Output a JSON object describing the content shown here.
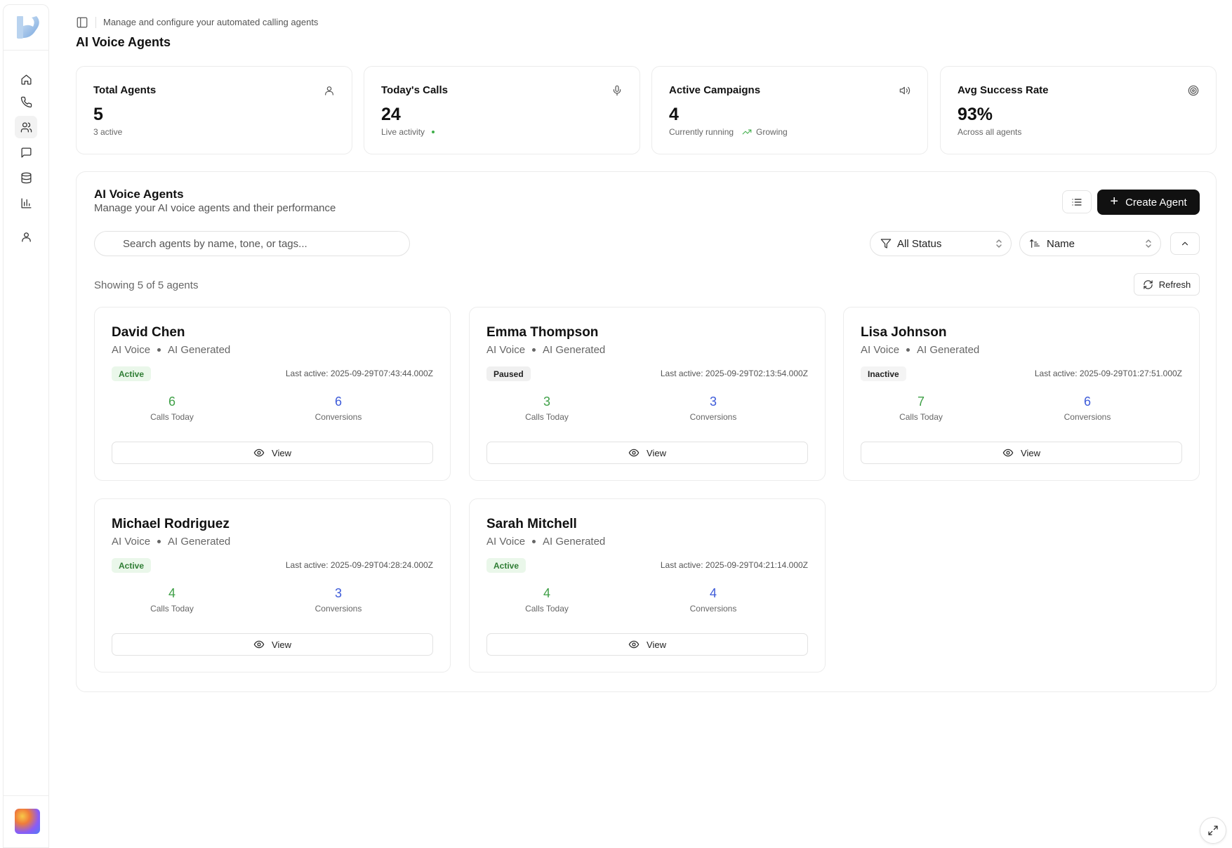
{
  "header": {
    "subtitle": "Manage and configure your automated calling agents",
    "title": "AI Voice Agents"
  },
  "sidebar": {
    "items": [
      {
        "icon": "home-icon"
      },
      {
        "icon": "phone-icon"
      },
      {
        "icon": "users-icon",
        "active": true
      },
      {
        "icon": "message-icon"
      },
      {
        "icon": "database-icon"
      },
      {
        "icon": "bar-chart-icon"
      },
      {
        "icon": "user-icon"
      }
    ]
  },
  "stats": [
    {
      "title": "Total Agents",
      "value": "5",
      "sub": "3 active",
      "icon": "user-icon"
    },
    {
      "title": "Today's Calls",
      "value": "24",
      "sub": "Live activity",
      "icon": "mic-icon"
    },
    {
      "title": "Active Campaigns",
      "value": "4",
      "sub": "Currently running",
      "trend": "Growing",
      "icon": "volume-icon"
    },
    {
      "title": "Avg Success Rate",
      "value": "93%",
      "sub": "Across all agents",
      "icon": "target-icon"
    }
  ],
  "panel": {
    "title": "AI Voice Agents",
    "description": "Manage your AI voice agents and their performance",
    "create_label": "Create Agent",
    "search_placeholder": "Search agents by name, tone, or tags...",
    "status_filter": "All Status",
    "sort_field": "Name",
    "showing": "Showing 5 of 5 agents",
    "refresh_label": "Refresh"
  },
  "agents": [
    {
      "name": "David Chen",
      "voice": "AI Voice",
      "source": "AI Generated",
      "status": "Active",
      "last_active": "Last active: 2025-09-29T07:43:44.000Z",
      "calls": "6",
      "calls_label": "Calls Today",
      "conversions": "6",
      "conversions_label": "Conversions",
      "view_label": "View"
    },
    {
      "name": "Emma Thompson",
      "voice": "AI Voice",
      "source": "AI Generated",
      "status": "Paused",
      "last_active": "Last active: 2025-09-29T02:13:54.000Z",
      "calls": "3",
      "calls_label": "Calls Today",
      "conversions": "3",
      "conversions_label": "Conversions",
      "view_label": "View"
    },
    {
      "name": "Lisa Johnson",
      "voice": "AI Voice",
      "source": "AI Generated",
      "status": "Inactive",
      "last_active": "Last active: 2025-09-29T01:27:51.000Z",
      "calls": "7",
      "calls_label": "Calls Today",
      "conversions": "6",
      "conversions_label": "Conversions",
      "view_label": "View"
    },
    {
      "name": "Michael Rodriguez",
      "voice": "AI Voice",
      "source": "AI Generated",
      "status": "Active",
      "last_active": "Last active: 2025-09-29T04:28:24.000Z",
      "calls": "4",
      "calls_label": "Calls Today",
      "conversions": "3",
      "conversions_label": "Conversions",
      "view_label": "View"
    },
    {
      "name": "Sarah Mitchell",
      "voice": "AI Voice",
      "source": "AI Generated",
      "status": "Active",
      "last_active": "Last active: 2025-09-29T04:21:14.000Z",
      "calls": "4",
      "calls_label": "Calls Today",
      "conversions": "4",
      "conversions_label": "Conversions",
      "view_label": "View"
    }
  ],
  "colors": {
    "calls": "#3fa047",
    "conversions": "#3d5bd9",
    "active_badge_bg": "#eaf7ea",
    "active_badge_text": "#2f7d34",
    "primary_button": "#111111"
  }
}
